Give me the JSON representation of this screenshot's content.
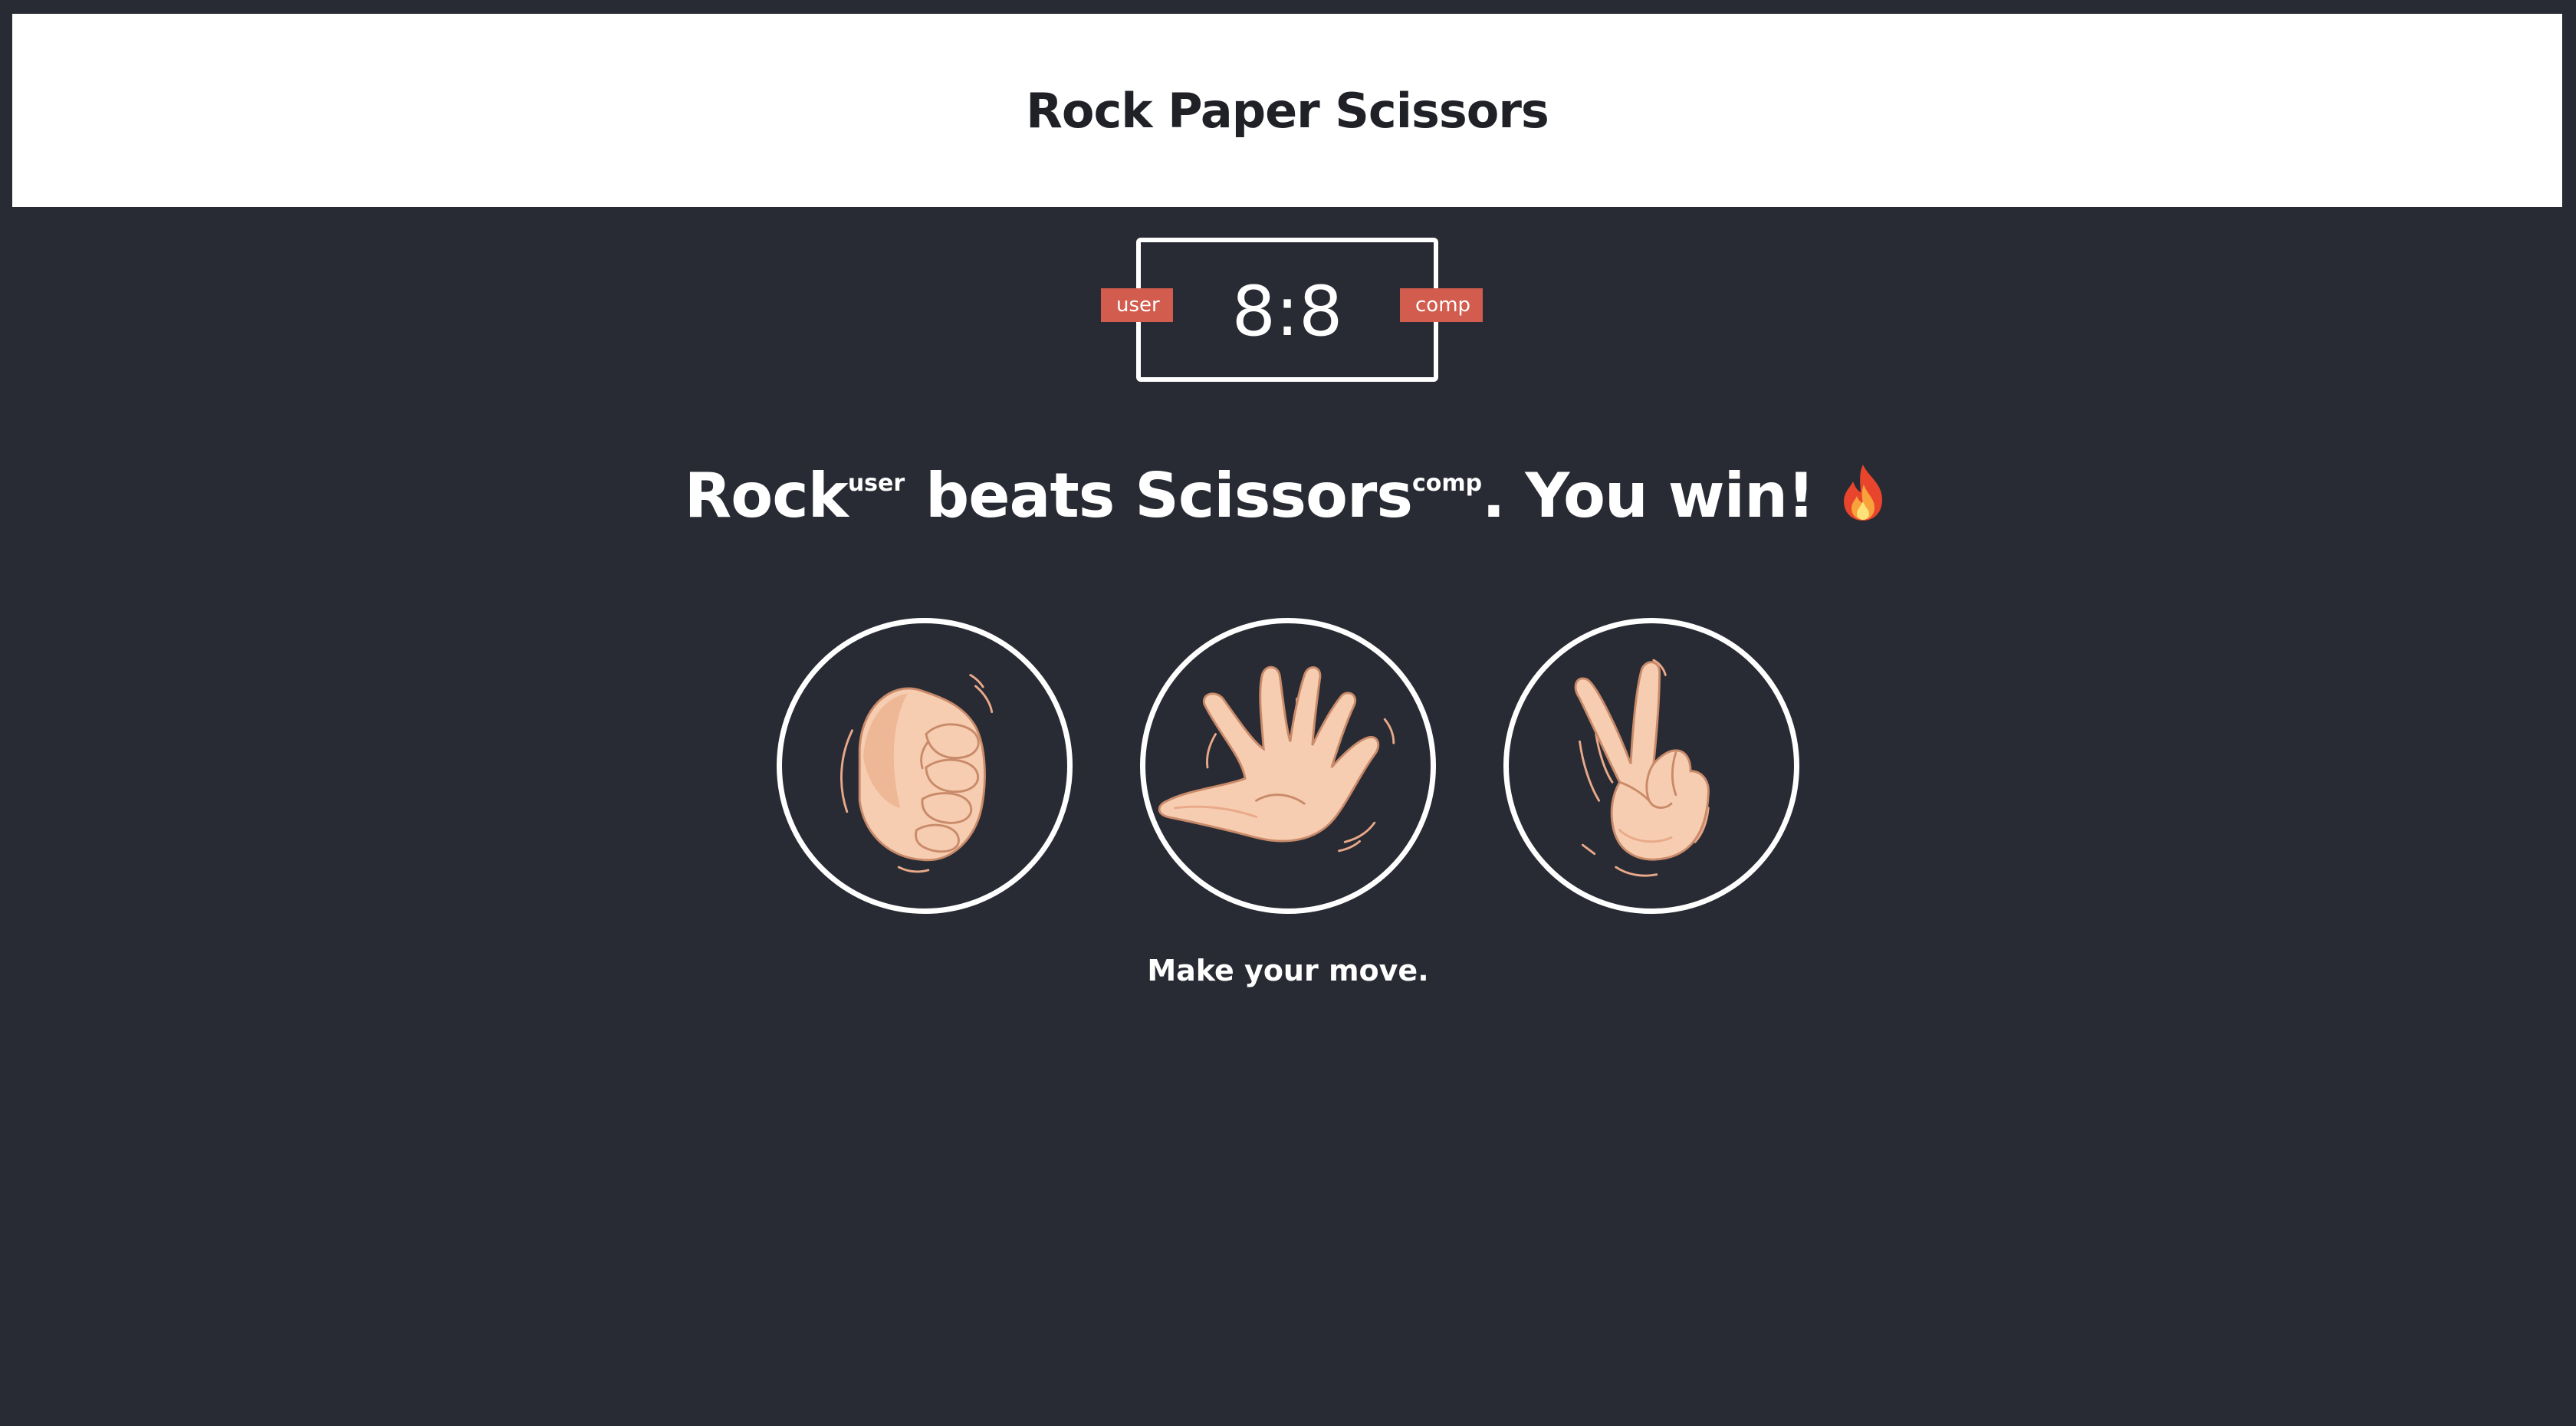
{
  "header": {
    "title": "Rock Paper Scissors"
  },
  "scoreboard": {
    "score_text": "8:8",
    "user_label": "user",
    "comp_label": "comp"
  },
  "result": {
    "user_choice": "Rock",
    "user_tag": "user",
    "verb": "beats",
    "comp_choice": "Scissors",
    "comp_tag": "comp",
    "outcome": ". You win!",
    "emoji": "🔥"
  },
  "choices": [
    {
      "name": "rock",
      "icon": "rock-fist-icon"
    },
    {
      "name": "paper",
      "icon": "paper-hand-icon"
    },
    {
      "name": "scissors",
      "icon": "scissors-victory-hand-icon"
    }
  ],
  "prompt": "Make your move.",
  "colors": {
    "background": "#282b33",
    "header_bg": "#ffffff",
    "badge": "#d25c4d",
    "skin": "#f6cdb0",
    "skin_shade": "#e9a98a"
  }
}
